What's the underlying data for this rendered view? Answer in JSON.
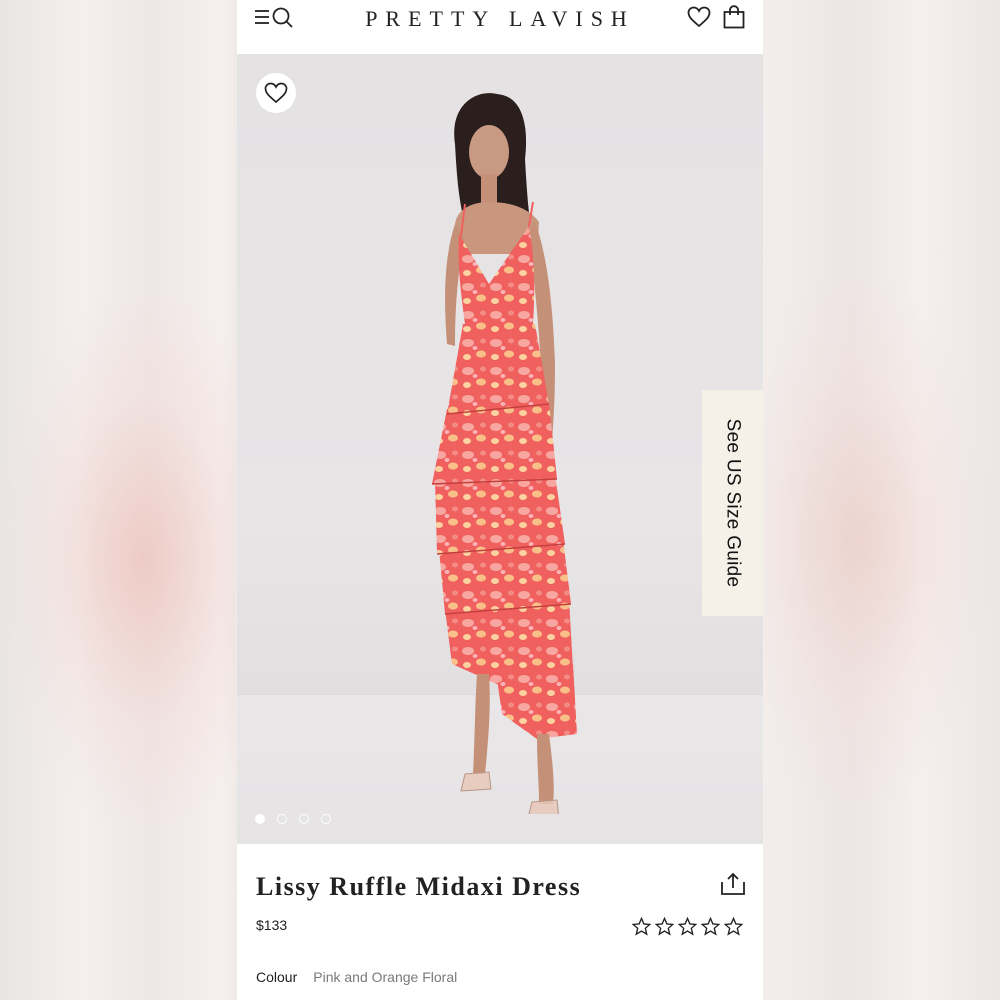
{
  "header": {
    "brand": "PRETTY LAVISH",
    "menu_icon": "menu-search-icon",
    "wishlist_icon": "heart-icon",
    "bag_icon": "shopping-bag-icon"
  },
  "gallery": {
    "size_guide_label": "See US Size Guide",
    "slides": [
      "1",
      "2",
      "3",
      "4"
    ],
    "active_slide": 1,
    "background_color": "#e4e2e3",
    "dress_color": "#f26b6b"
  },
  "product": {
    "title": "Lissy Ruffle Midaxi Dress",
    "price": "$133",
    "rating_stars": 0,
    "rating_max": 5,
    "colour_label": "Colour",
    "colour_value": "Pink and Orange Floral"
  }
}
